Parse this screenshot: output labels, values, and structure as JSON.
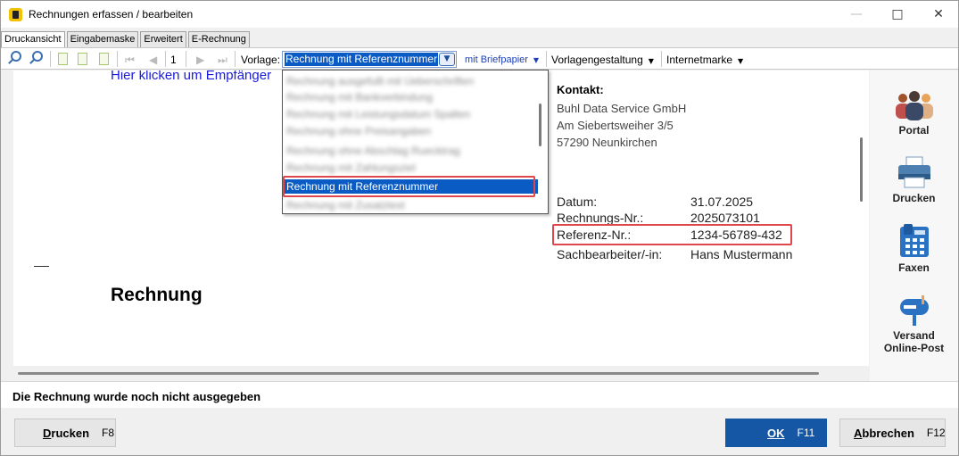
{
  "window": {
    "title": "Rechnungen erfassen / bearbeiten",
    "minimize_icon": "—",
    "maximize_icon": "□",
    "close_icon": "✕"
  },
  "tabs": [
    {
      "label": "Druckansicht",
      "active": true
    },
    {
      "label": "Eingabemaske",
      "active": false
    },
    {
      "label": "Erweitert",
      "active": false
    },
    {
      "label": "E-Rechnung",
      "active": false
    }
  ],
  "toolbar": {
    "page_number": "1",
    "vorlage_label": "Vorlage:",
    "vorlage_value": "Rechnung mit Referenznummer",
    "briefpapier": "mit Briefpapier",
    "vorlagengestaltung": "Vorlagengestaltung",
    "internetmarke": "Internetmarke",
    "nav_first": "⏮",
    "nav_prev": "◀",
    "nav_next": "▶",
    "nav_last": "⏭"
  },
  "dropdown": {
    "items": [
      {
        "label": "Rechnung ausgefullt mit Ueberschriften",
        "blurred": true
      },
      {
        "label": "Rechnung mit Bankverbindung",
        "blurred": true
      },
      {
        "label": "Rechnung mit Leistungsdatum Spalten",
        "blurred": true
      },
      {
        "label": "Rechnung ohne Preisangaben",
        "blurred": true
      },
      {
        "label": "Rechnung ohne Abschlag Ruecktrag",
        "blurred": true
      },
      {
        "label": "Rechnung mit Zahlungsziel",
        "blurred": true
      },
      {
        "label": "Rechnung mit Referenznummer",
        "selected": true
      },
      {
        "label": "Rechnung mit Zusatztext",
        "blurred": true
      }
    ]
  },
  "document": {
    "empfaenger_link": "Hier klicken um Empfänger",
    "title": "Rechnung",
    "kontakt": {
      "label": "Kontakt:",
      "company": "Buhl Data Service GmbH",
      "street": "Am Siebertsweiher 3/5",
      "city": "57290 Neunkirchen"
    },
    "info": [
      {
        "label": "Datum:",
        "value": "31.07.2025"
      },
      {
        "label": "Rechnungs-Nr.:",
        "value": "2025073101"
      },
      {
        "label": "Referenz-Nr.:",
        "value": "1234-56789-432"
      },
      {
        "label": "Sachbearbeiter/-in:",
        "value": "Hans Mustermann"
      }
    ]
  },
  "side_actions": [
    {
      "label": "Portal",
      "icon": "people-icon"
    },
    {
      "label": "Drucken",
      "icon": "printer-icon"
    },
    {
      "label": "Faxen",
      "icon": "fax-icon"
    },
    {
      "label": "Versand",
      "label2": "Online-Post",
      "icon": "mailbox-icon"
    }
  ],
  "status": {
    "message": "Die Rechnung wurde noch nicht ausgegeben"
  },
  "buttons": {
    "print": {
      "label_first": "D",
      "label_rest": "rucken",
      "key": "F8"
    },
    "ok": {
      "label": "OK",
      "key": "F11"
    },
    "cancel": {
      "label_first": "A",
      "label_rest": "bbrechen",
      "key": "F12"
    }
  },
  "colors": {
    "accent": "#1557a5",
    "selection": "#0a5bc4",
    "highlight_box": "#e0474c",
    "link": "#1a1ad8"
  }
}
